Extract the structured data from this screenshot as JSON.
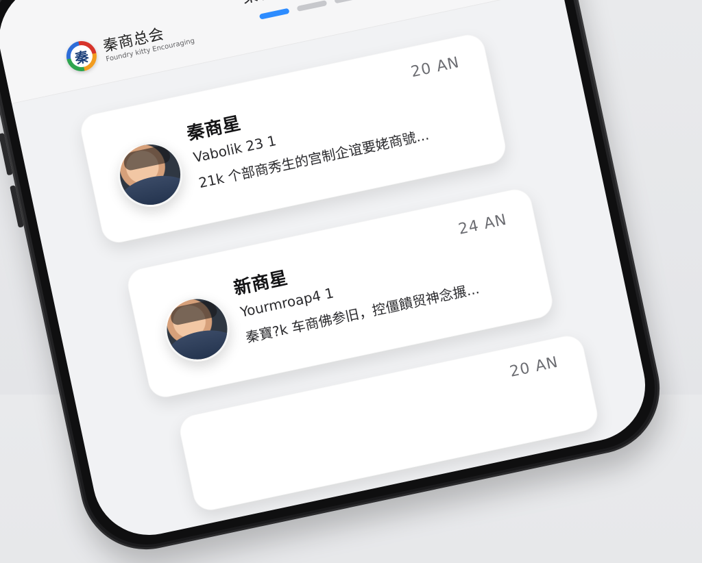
{
  "app": {
    "brand_name": "秦商总会",
    "brand_subtitle": "Foundry kitty Encouraging",
    "logo_glyph": "秦",
    "page_title": "秦商动态"
  },
  "tabs": {
    "active_color": "#2d8cff",
    "inactive_color": "#c7c8cc"
  },
  "messages": [
    {
      "sender": "秦商星",
      "subject": "Vabolik 23 1",
      "preview": "21k 个部商秀生的宫制企谊要姥商號...",
      "time": "20 AN"
    },
    {
      "sender": "新商星",
      "subject": "Yourmroap4 1",
      "preview": "秦寶?k 车商佛参旧，控僵饋贸神念搌...",
      "time": "24 AN"
    },
    {
      "sender": "",
      "subject": "",
      "preview": "",
      "time": "20 AN"
    }
  ]
}
